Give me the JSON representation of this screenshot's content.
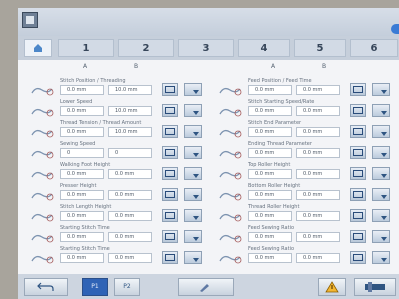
{
  "tabs": [
    "1",
    "2",
    "3",
    "4",
    "5",
    "6"
  ],
  "left_panel": {
    "col_a": "A",
    "col_b": "B",
    "rows": [
      {
        "icon": "needle-position-icon",
        "label": "Stitch Position / Threading",
        "a": "0.0 mm",
        "b": "10.0 mm"
      },
      {
        "icon": "thread-path-icon",
        "label": "Lower Speed",
        "a": "0.0 mm",
        "b": "10.0 mm"
      },
      {
        "icon": "thread-tension-icon",
        "label": "Thread Tension / Thread Amount",
        "a": "0.0 mm",
        "b": "10.0 mm"
      },
      {
        "icon": "spool-icon",
        "label": "Sewing Speed",
        "a": "0",
        "b": "0"
      },
      {
        "icon": "presser-foot-icon",
        "label": "Walking Foot Height",
        "a": "0.0 mm",
        "b": "0.0 mm"
      },
      {
        "icon": "feed-dog-icon",
        "label": "Presser Height",
        "a": "0.0 mm",
        "b": "0.0 mm"
      },
      {
        "icon": "stitch-length-icon",
        "label": "Stitch Length Height",
        "a": "0.0 mm",
        "b": "0.0 mm"
      },
      {
        "icon": "needle-thread-icon",
        "label": "Starting Stitch Time",
        "a": "0.0 mm",
        "b": "0.0 mm"
      },
      {
        "icon": "bobbin-icon",
        "label": "Starting Stitch Time",
        "a": "0.0 mm",
        "b": "0.0 mm"
      }
    ]
  },
  "right_panel": {
    "col_a": "A",
    "col_b": "B",
    "rows": [
      {
        "icon": "upper-feed-icon",
        "label": "Feed Position / Feed Time",
        "a": "0.0 mm",
        "b": "0.0 mm"
      },
      {
        "icon": "lower-feed-icon",
        "label": "Stitch Starting Speed/Rate",
        "a": "0.0 mm",
        "b": "0.0 mm"
      },
      {
        "icon": "puller-icon",
        "label": "Stitch End Parameter",
        "a": "0.0 mm",
        "b": "0.0 mm"
      },
      {
        "icon": "needle-cooler-icon",
        "label": "Ending Thread Parameter",
        "a": "0.0 mm",
        "b": "0.0 mm"
      },
      {
        "icon": "edge-guide-icon",
        "label": "Top Roller Height",
        "a": "0.0 mm",
        "b": "0.0 mm"
      },
      {
        "icon": "roller-height-icon",
        "label": "Bottom Roller Height",
        "a": "0.0 mm",
        "b": "0.0 mm"
      },
      {
        "icon": "roller-pressure-icon",
        "label": "Thread Roller Height",
        "a": "0.0 mm",
        "b": "0.0 mm"
      },
      {
        "icon": "feed-tilt-icon",
        "label": "Feed Sewing Ratio",
        "a": "0.0 mm",
        "b": "0.0 mm"
      },
      {
        "icon": "feed-dog-ratio-icon",
        "label": "Feed Sewing Ratio",
        "a": "0.0 mm",
        "b": "0.0 mm"
      }
    ]
  },
  "footer": {
    "back_icon": "return-arrow-icon",
    "b1": "P1",
    "b2": "P2",
    "tool_icon": "pen-icon",
    "warning_icon": "warning-icon",
    "home_icon": "machine-icon"
  }
}
